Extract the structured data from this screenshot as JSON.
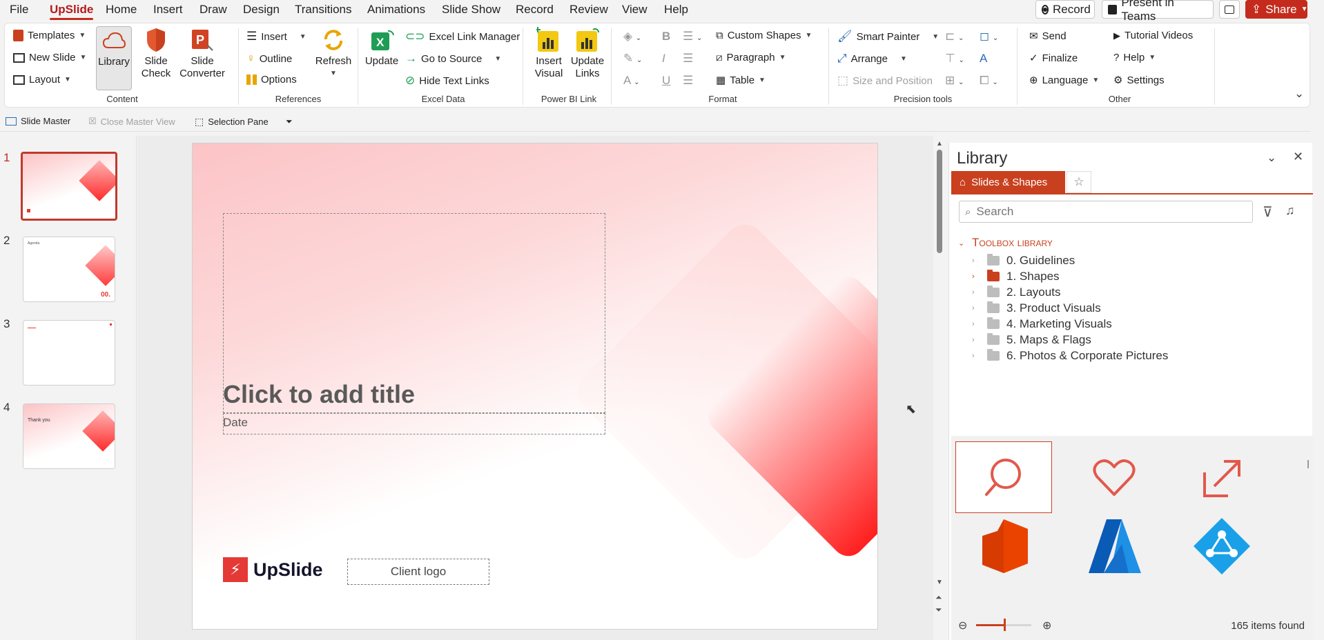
{
  "tabs": [
    "File",
    "UpSlide",
    "Home",
    "Insert",
    "Draw",
    "Design",
    "Transitions",
    "Animations",
    "Slide Show",
    "Record",
    "Review",
    "View",
    "Help"
  ],
  "active_tab": "UpSlide",
  "top_buttons": {
    "record": "Record",
    "present_teams": "Present in Teams",
    "share": "Share"
  },
  "ribbon": {
    "content": {
      "label": "Content",
      "templates": "Templates",
      "new_slide": "New Slide",
      "layout": "Layout",
      "library": "Library",
      "slide_check": "Slide Check",
      "slide_converter": "Slide Converter"
    },
    "references": {
      "label": "References",
      "insert": "Insert",
      "outline": "Outline",
      "options": "Options",
      "refresh": "Refresh"
    },
    "excel_data": {
      "label": "Excel Data",
      "update": "Update",
      "excel_link_manager": "Excel Link Manager",
      "go_to_source": "Go to Source",
      "hide_text_links": "Hide Text Links"
    },
    "power_bi": {
      "label": "Power BI Link",
      "insert_visual": "Insert Visual",
      "update_links": "Update Links"
    },
    "format": {
      "label": "Format",
      "custom_shapes": "Custom Shapes",
      "paragraph": "Paragraph",
      "table": "Table"
    },
    "precision": {
      "label": "Precision tools",
      "smart_painter": "Smart Painter",
      "arrange": "Arrange",
      "size_position": "Size and Position"
    },
    "other": {
      "label": "Other",
      "send": "Send",
      "finalize": "Finalize",
      "language": "Language",
      "tutorial_videos": "Tutorial Videos",
      "help": "Help",
      "settings": "Settings"
    }
  },
  "quickbar": {
    "slide_master": "Slide Master",
    "close_master_view": "Close Master View",
    "selection_pane": "Selection Pane"
  },
  "slides": [
    {
      "number": "1",
      "active": true
    },
    {
      "number": "2",
      "active": false,
      "title": "Agenda",
      "badge": "00."
    },
    {
      "number": "3",
      "active": false
    },
    {
      "number": "4",
      "active": false,
      "title": "Thank you"
    }
  ],
  "slide": {
    "title_placeholder": "Click to add title",
    "date_placeholder": "Date",
    "brand_name": "UpSlide",
    "client_logo": "Client logo"
  },
  "library": {
    "title": "Library",
    "tab_label": "Slides & Shapes",
    "search_placeholder": "Search",
    "root": "Toolbox library",
    "folders": [
      {
        "label": "0. Guidelines",
        "highlight": false
      },
      {
        "label": "1. Shapes",
        "highlight": true
      },
      {
        "label": "2. Layouts",
        "highlight": false
      },
      {
        "label": "3. Product Visuals",
        "highlight": false
      },
      {
        "label": "4. Marketing Visuals",
        "highlight": false
      },
      {
        "label": "5. Maps & Flags",
        "highlight": false
      },
      {
        "label": "6. Photos & Corporate Pictures",
        "highlight": false
      }
    ],
    "items_found": "165 items found",
    "grid_icons": [
      "search-icon",
      "heart-icon",
      "arrow-up-right-icon",
      "office-icon",
      "azure-icon",
      "azure-ad-icon"
    ]
  },
  "colors": {
    "accent": "#c42b1c",
    "library_accent": "#c9401f",
    "slide_gradient": "#fcc4c6"
  }
}
